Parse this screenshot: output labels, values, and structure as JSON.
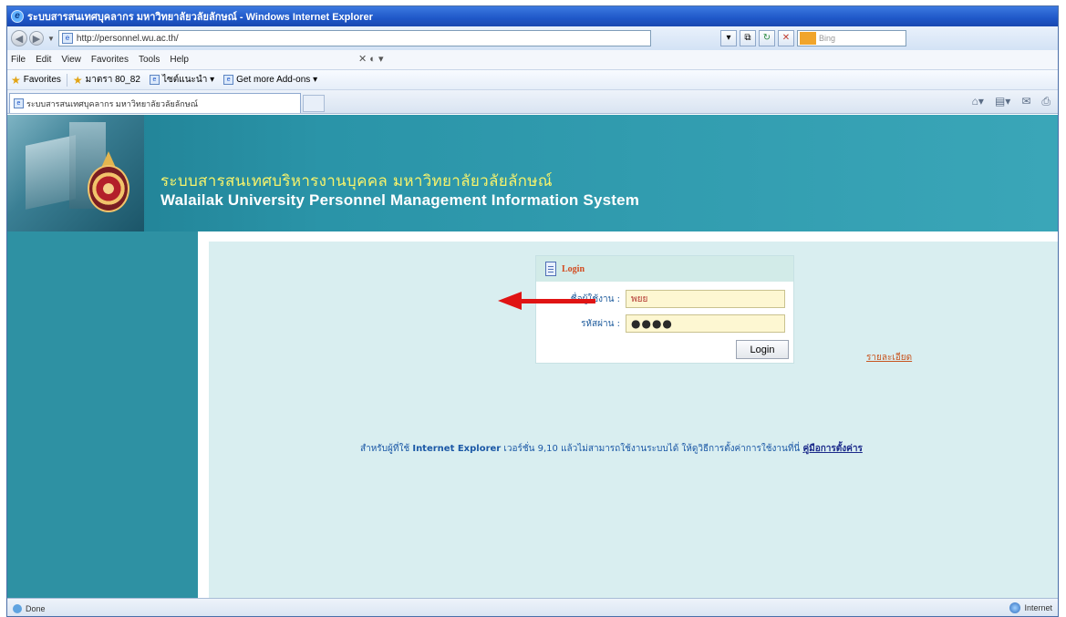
{
  "window": {
    "title": "ระบบสารสนเทศบุคลากร มหาวิทยาลัยวลัยลักษณ์ - Windows Internet Explorer"
  },
  "address_bar": {
    "url": "http://personnel.wu.ac.th/",
    "search_placeholder": "Bing"
  },
  "menu": {
    "items": [
      "File",
      "Edit",
      "View",
      "Favorites",
      "Tools",
      "Help"
    ]
  },
  "favorites_bar": {
    "favorites_label": "Favorites",
    "items": [
      "มาตรา 80_82",
      "ไซต์แนะนำ ▾",
      "Get more Add-ons ▾"
    ]
  },
  "tab": {
    "title": "ระบบสารสนเทศบุคลากร มหาวิทยาลัยวลัยลักษณ์"
  },
  "banner": {
    "title_th": "ระบบสารสนเทศบริหารงานบุคคล มหาวิทยาลัยวลัยลักษณ์",
    "title_en": "Walailak University Personnel  Management Information System"
  },
  "login": {
    "heading": "Login",
    "username_label": "ชื่อผู้ใช้งาน :",
    "username_value": "พยย",
    "password_label": "รหัสผ่าน :",
    "password_value": "●●●●",
    "button_label": "Login"
  },
  "details_link": "รายละเอียด",
  "notice": {
    "prefix": "สำหรับผู้ที่ใช้ ",
    "bold": "Internet Explorer",
    "middle": " เวอร์ชั่น 9,10 แล้วไม่สามารถใช้งานระบบได้ ให้ดูวิธีการตั้งค่าการใช้งานที่นี่ ",
    "link": "คู่มือการตั้งค่าร"
  },
  "status_bar": {
    "left": "Done",
    "right": "Internet"
  },
  "colors": {
    "teal_bg": "#2e91a3",
    "content_bg": "#d9eef0",
    "arrow": "#e01414",
    "banner_th": "#f7f36b"
  }
}
